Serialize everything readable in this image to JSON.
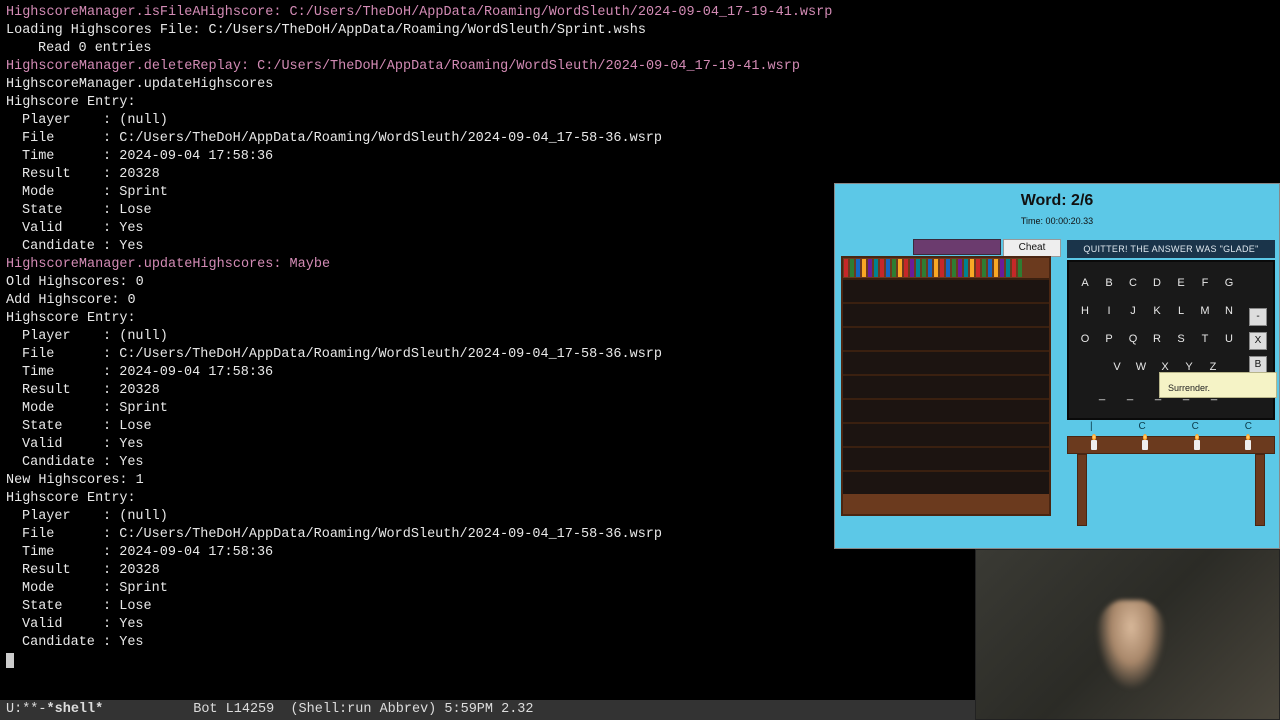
{
  "terminal": {
    "lines": [
      {
        "cls": "pink",
        "text": "HighscoreManager.isFileAHighscore: C:/Users/TheDoH/AppData/Roaming/WordSleuth/2024-09-04_17-19-41.wsrp"
      },
      {
        "cls": "white",
        "text": "Loading Highscores File: C:/Users/TheDoH/AppData/Roaming/WordSleuth/Sprint.wshs"
      },
      {
        "cls": "white ind2",
        "text": "Read 0 entries"
      },
      {
        "cls": "pink",
        "text": "HighscoreManager.deleteReplay: C:/Users/TheDoH/AppData/Roaming/WordSleuth/2024-09-04_17-19-41.wsrp"
      },
      {
        "cls": "white",
        "text": "HighscoreManager.updateHighscores"
      },
      {
        "cls": "white",
        "text": "Highscore Entry:"
      },
      {
        "cls": "white ind",
        "text": "Player    : (null)"
      },
      {
        "cls": "white ind",
        "text": "File      : C:/Users/TheDoH/AppData/Roaming/WordSleuth/2024-09-04_17-58-36.wsrp"
      },
      {
        "cls": "white ind",
        "text": "Time      : 2024-09-04 17:58:36"
      },
      {
        "cls": "white ind",
        "text": "Result    : 20328"
      },
      {
        "cls": "white ind",
        "text": "Mode      : Sprint"
      },
      {
        "cls": "white ind",
        "text": "State     : Lose"
      },
      {
        "cls": "white ind",
        "text": "Valid     : Yes"
      },
      {
        "cls": "white ind",
        "text": "Candidate : Yes"
      },
      {
        "cls": "pink",
        "text": "HighscoreManager.updateHighscores: Maybe"
      },
      {
        "cls": "white",
        "text": "Old Highscores: 0"
      },
      {
        "cls": "white",
        "text": "Add Highscore: 0"
      },
      {
        "cls": "white",
        "text": "Highscore Entry:"
      },
      {
        "cls": "white ind",
        "text": "Player    : (null)"
      },
      {
        "cls": "white ind",
        "text": "File      : C:/Users/TheDoH/AppData/Roaming/WordSleuth/2024-09-04_17-58-36.wsrp"
      },
      {
        "cls": "white ind",
        "text": "Time      : 2024-09-04 17:58:36"
      },
      {
        "cls": "white ind",
        "text": "Result    : 20328"
      },
      {
        "cls": "white ind",
        "text": "Mode      : Sprint"
      },
      {
        "cls": "white ind",
        "text": "State     : Lose"
      },
      {
        "cls": "white ind",
        "text": "Valid     : Yes"
      },
      {
        "cls": "white ind",
        "text": "Candidate : Yes"
      },
      {
        "cls": "white",
        "text": "New Highscores: 1"
      },
      {
        "cls": "white",
        "text": "Highscore Entry:"
      },
      {
        "cls": "white ind",
        "text": "Player    : (null)"
      },
      {
        "cls": "white ind",
        "text": "File      : C:/Users/TheDoH/AppData/Roaming/WordSleuth/2024-09-04_17-58-36.wsrp"
      },
      {
        "cls": "white ind",
        "text": "Time      : 2024-09-04 17:58:36"
      },
      {
        "cls": "white ind",
        "text": "Result    : 20328"
      },
      {
        "cls": "white ind",
        "text": "Mode      : Sprint"
      },
      {
        "cls": "white ind",
        "text": "State     : Lose"
      },
      {
        "cls": "white ind",
        "text": "Valid     : Yes"
      },
      {
        "cls": "white ind",
        "text": "Candidate : Yes"
      }
    ],
    "modeline": {
      "left": "U:**-",
      "buffer": "*shell*",
      "pos": "Bot L14259",
      "mode": "(Shell:run Abbrev)",
      "time": "5:59PM",
      "load": "2.32"
    }
  },
  "game": {
    "word_label": "Word: 2/6",
    "time_label": "Time: 00:00:20.33",
    "tab_cheat": "Cheat",
    "banner": "QUITTER! THE ANSWER WAS \"GLADE\"",
    "keys_rows": [
      [
        "A",
        "B",
        "C",
        "D",
        "E",
        "F",
        "G"
      ],
      [
        "H",
        "I",
        "J",
        "K",
        "L",
        "M",
        "N"
      ],
      [
        "O",
        "P",
        "Q",
        "R",
        "S",
        "T",
        "U"
      ],
      [
        "V",
        "W",
        "X",
        "Y",
        "Z"
      ]
    ],
    "side_buttons": [
      "-",
      "X",
      "B"
    ],
    "tooltip": "Surrender.",
    "underbar_marks": [
      "|",
      "C",
      "C",
      "C"
    ]
  }
}
